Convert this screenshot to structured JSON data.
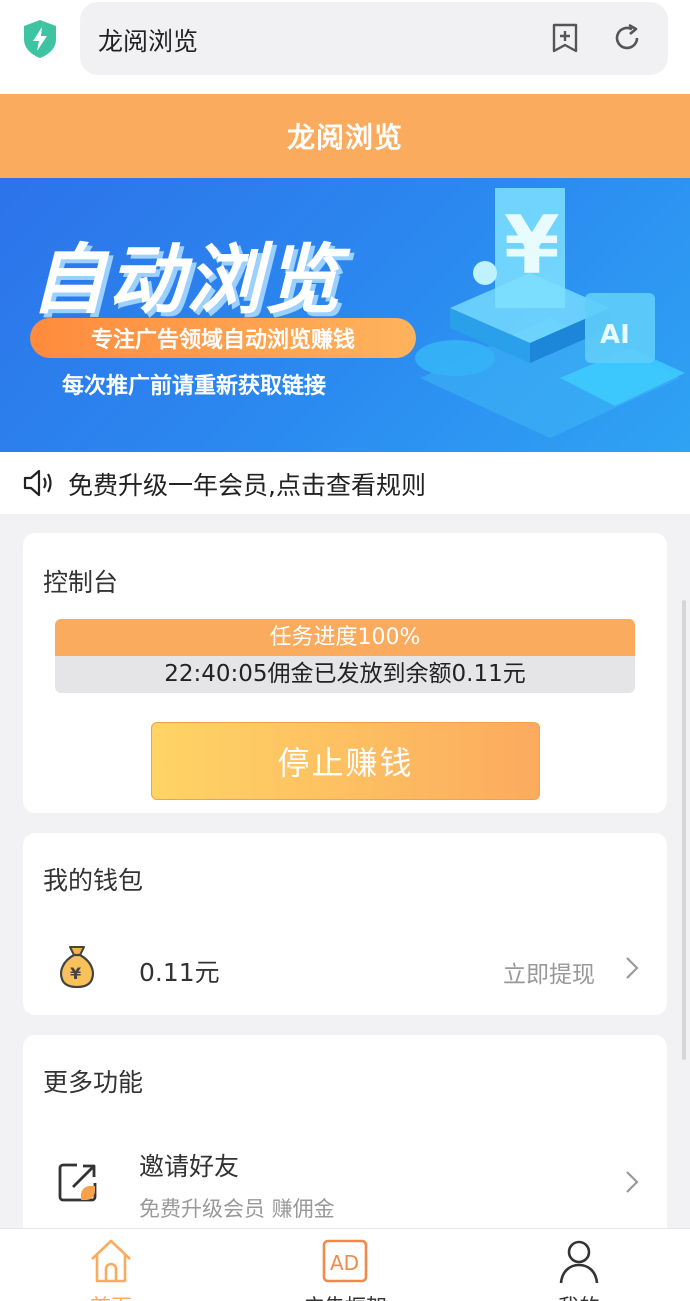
{
  "browser": {
    "url_text": "龙阅浏览",
    "icons": [
      "shield-bolt-icon",
      "bookmark-add-icon",
      "refresh-icon"
    ]
  },
  "header": {
    "title": "龙阅浏览"
  },
  "banner": {
    "headline": "自动浏览",
    "pill_text": "专注广告领域自动浏览赚钱",
    "sub_text": "每次推广前请重新获取链接"
  },
  "notice": {
    "text": "免费升级一年会员,点击查看规则"
  },
  "console": {
    "title": "控制台",
    "progress_label": "任务进度100%",
    "progress_value": 100,
    "progress_message": "22:40:05佣金已发放到余额0.11元",
    "stop_button": "停止赚钱"
  },
  "wallet": {
    "title": "我的钱包",
    "amount": "0.11元",
    "withdraw_label": "立即提现"
  },
  "more": {
    "title": "更多功能",
    "items": [
      {
        "title": "邀请好友",
        "subtitle": "免费升级会员 赚佣金"
      }
    ]
  },
  "nav": {
    "items": [
      {
        "label": "首页",
        "active": true
      },
      {
        "label": "广告框架",
        "active": false
      },
      {
        "label": "我的",
        "active": false
      }
    ]
  },
  "colors": {
    "accent": "#fbab5e",
    "banner_blue": "#2b7ff0",
    "active_tab": "#fbab5e"
  }
}
